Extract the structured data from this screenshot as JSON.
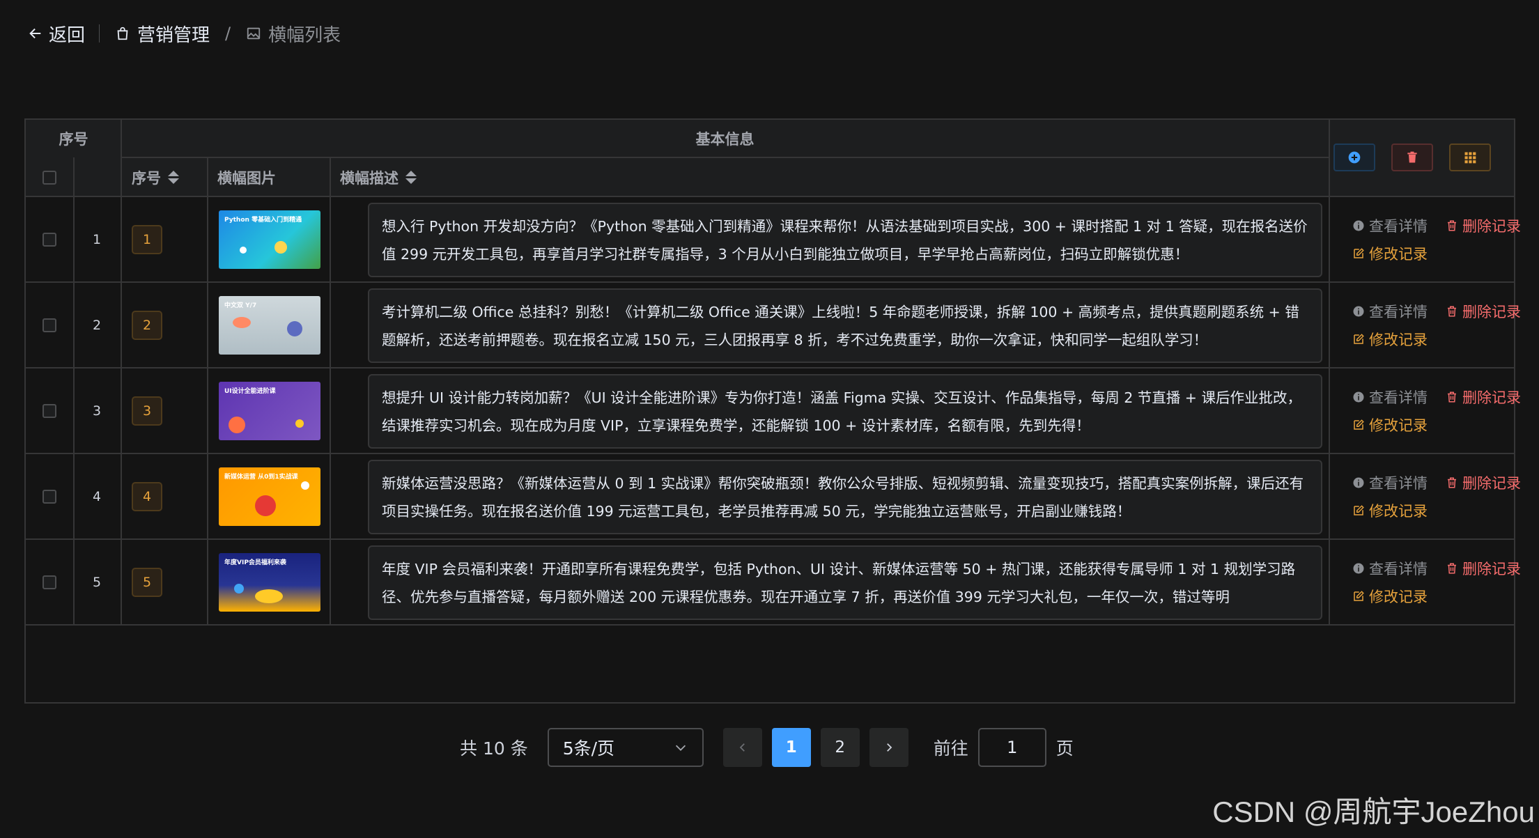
{
  "breadcrumb": {
    "back_label": "返回",
    "section_label": "营销管理",
    "page_label": "横幅列表",
    "separator": "/"
  },
  "table": {
    "group_headers": {
      "index": "序号",
      "basic_info": "基本信息"
    },
    "columns": {
      "seq": "序号",
      "image": "横幅图片",
      "desc": "横幅描述"
    },
    "toolbar": {
      "add_icon": "plus-circle-icon",
      "delete_icon": "trash-icon",
      "grid_icon": "grid-icon"
    },
    "actions": {
      "view": "查看详情",
      "delete": "删除记录",
      "edit": "修改记录"
    },
    "rows": [
      {
        "index": "1",
        "seq": "1",
        "thumb_title": "Python 零基础入门到精通",
        "description": "想入行 Python 开发却没方向？《Python 零基础入门到精通》课程来帮你！从语法基础到项目实战，300 + 课时搭配 1 对 1 答疑，现在报名送价值 299 元开发工具包，再享首月学习社群专属指导，3 个月从小白到能独立做项目，早学早抢占高薪岗位，扫码立即解锁优惠！"
      },
      {
        "index": "2",
        "seq": "2",
        "thumb_title": "中文双 Y/7",
        "description": "考计算机二级 Office 总挂科？别愁！《计算机二级 Office 通关课》上线啦！5 年命题老师授课，拆解 100 + 高频考点，提供真题刷题系统 + 错题解析，还送考前押题卷。现在报名立减 150 元，三人团报再享 8 折，考不过免费重学，助你一次拿证，快和同学一起组队学习！"
      },
      {
        "index": "3",
        "seq": "3",
        "thumb_title": "UI设计全能进阶课",
        "description": "想提升 UI 设计能力转岗加薪？《UI 设计全能进阶课》专为你打造！涵盖 Figma 实操、交互设计、作品集指导，每周 2 节直播 + 课后作业批改，结课推荐实习机会。现在成为月度 VIP，立享课程免费学，还能解锁 100 + 设计素材库，名额有限，先到先得！"
      },
      {
        "index": "4",
        "seq": "4",
        "thumb_title": "新媒体运营 从0到1实战课",
        "description": "新媒体运营没思路？《新媒体运营从 0 到 1 实战课》帮你突破瓶颈！教你公众号排版、短视频剪辑、流量变现技巧，搭配真实案例拆解，课后还有项目实操任务。现在报名送价值 199 元运营工具包，老学员推荐再减 50 元，学完能独立运营账号，开启副业赚钱路！"
      },
      {
        "index": "5",
        "seq": "5",
        "thumb_title": "年度VIP会员福利来袭",
        "description": "年度 VIP 会员福利来袭！开通即享所有课程免费学，包括 Python、UI 设计、新媒体运营等 50 + 热门课，还能获得专属导师 1 对 1 规划学习路径、优先参与直播答疑，每月额外赠送 200 元课程优惠券。现在开通立享 7 折，再送价值 399 元学习大礼包，一年仅一次，错过等明"
      }
    ]
  },
  "pagination": {
    "total_label": "共 10 条",
    "page_size": "5条/页",
    "pages": [
      "1",
      "2"
    ],
    "current_page": "1",
    "goto_label": "前往",
    "goto_value": "1",
    "page_suffix": "页"
  },
  "watermark": "CSDN @周航宇JoeZhou",
  "colors": {
    "background": "#141414",
    "header_bg": "#1d1e1f",
    "border": "#363637",
    "primary": "#409eff",
    "danger": "#f56c6c",
    "warning": "#e6a23c"
  }
}
